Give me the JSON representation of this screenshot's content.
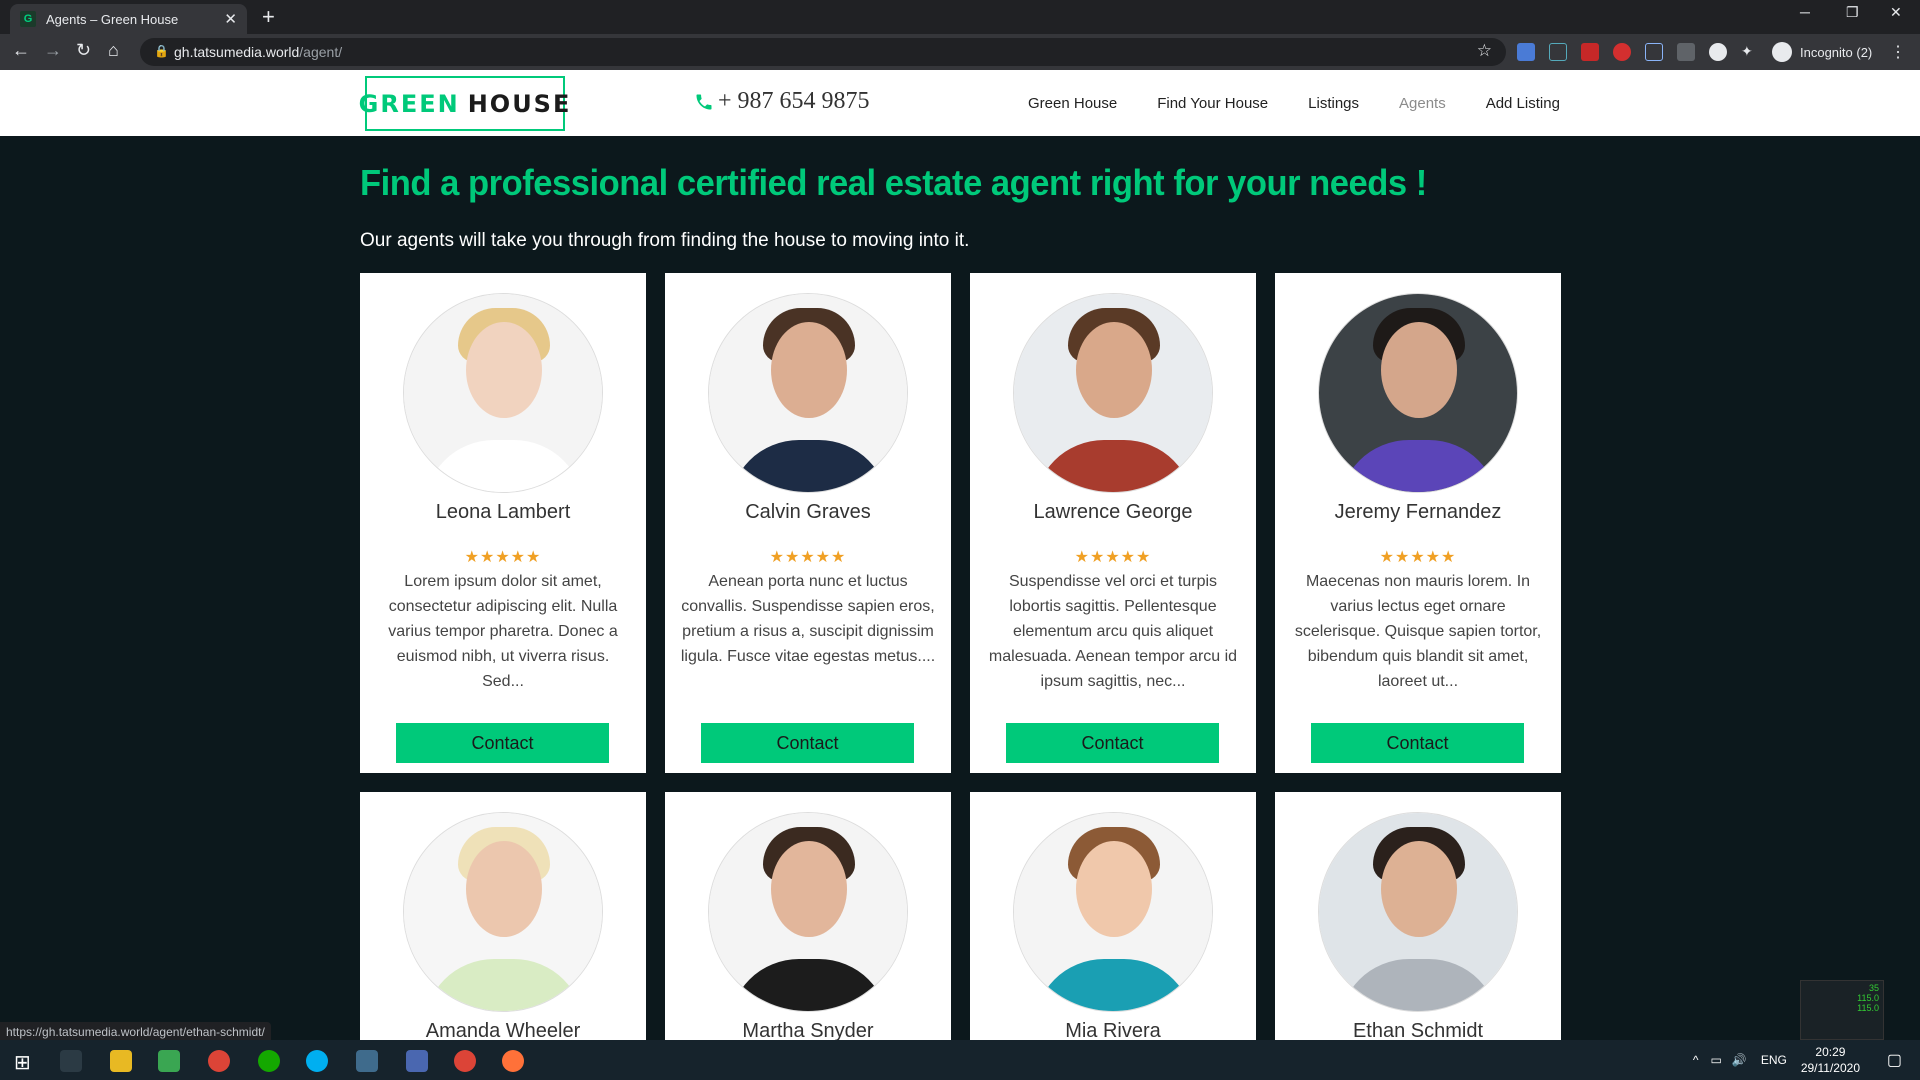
{
  "browser": {
    "tab_title": "Agents – Green House",
    "favicon_letter": "G",
    "url_host": "gh.tatsumedia.world",
    "url_path": "/agent/",
    "profile_label": "Incognito (2)",
    "status_url": "https://gh.tatsumedia.world/agent/ethan-schmidt/"
  },
  "site": {
    "logo_left": "GREEN",
    "logo_right": "HOUSE",
    "phone": "+ 987 654 9875",
    "nav": [
      "Green House",
      "Find Your House",
      "Listings",
      "Agents",
      "Add Listing"
    ],
    "active_nav": "Agents"
  },
  "hero": {
    "title": "Find a professional certified real estate agent right for your needs !",
    "subtitle": "Our agents will take you through from finding the house to moving into it."
  },
  "agents": [
    {
      "name": "Leona Lambert",
      "rating": 5,
      "bio": "Lorem ipsum dolor sit amet, consectetur adipiscing elit. Nulla varius tempor pharetra. Donec a euismod nibh, ut viverra risus. Sed...",
      "button": "Contact"
    },
    {
      "name": "Calvin Graves",
      "rating": 5,
      "bio": "Aenean porta nunc et luctus convallis. Suspendisse sapien eros, pretium a risus a, suscipit dignissim ligula. Fusce vitae egestas metus....",
      "button": "Contact"
    },
    {
      "name": "Lawrence George",
      "rating": 5,
      "bio": "Suspendisse vel orci et turpis lobortis sagittis. Pellentesque elementum arcu quis aliquet malesuada. Aenean tempor arcu id ipsum sagittis, nec...",
      "button": "Contact"
    },
    {
      "name": "Jeremy Fernandez",
      "rating": 5,
      "bio": "Maecenas non mauris lorem. In varius lectus eget ornare scelerisque. Quisque sapien tortor, bibendum quis blandit sit amet, laoreet ut...",
      "button": "Contact"
    },
    {
      "name": "Amanda Wheeler"
    },
    {
      "name": "Martha Snyder"
    },
    {
      "name": "Mia Rivera"
    },
    {
      "name": "Ethan Schmidt"
    }
  ],
  "colors": {
    "accent": "#00c97a",
    "page_bg": "#0c181c",
    "star": "#f0a024"
  },
  "system": {
    "language": "ENG",
    "time": "20:29",
    "date": "29/11/2020"
  }
}
